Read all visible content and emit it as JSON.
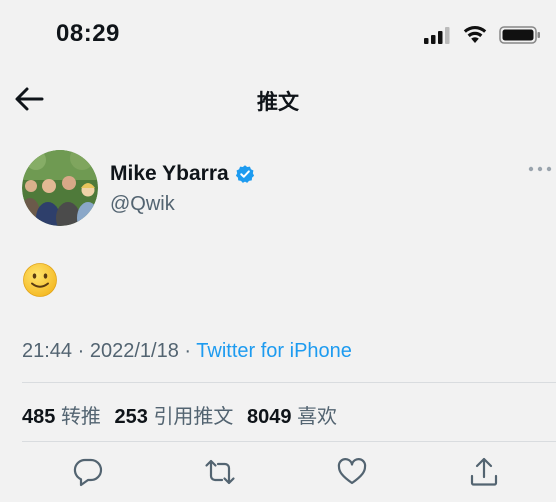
{
  "status_bar": {
    "time": "08:29"
  },
  "nav": {
    "title": "推文"
  },
  "tweet": {
    "author_name": "Mike Ybarra",
    "author_handle": "@Qwik",
    "time": "21:44",
    "date": "2022/1/18",
    "separator": "·",
    "source": "Twitter for iPhone",
    "body_emoji": "slightly-smiling-face"
  },
  "stats": {
    "retweets_count": "485",
    "retweets_label": "转推",
    "quotes_count": "253",
    "quotes_label": "引用推文",
    "likes_count": "8049",
    "likes_label": "喜欢"
  },
  "colors": {
    "background": "#f2f2f2",
    "text": "#0f1419",
    "secondary": "#536471",
    "accent": "#1d9bf0",
    "verified": "#1d9bf0"
  }
}
